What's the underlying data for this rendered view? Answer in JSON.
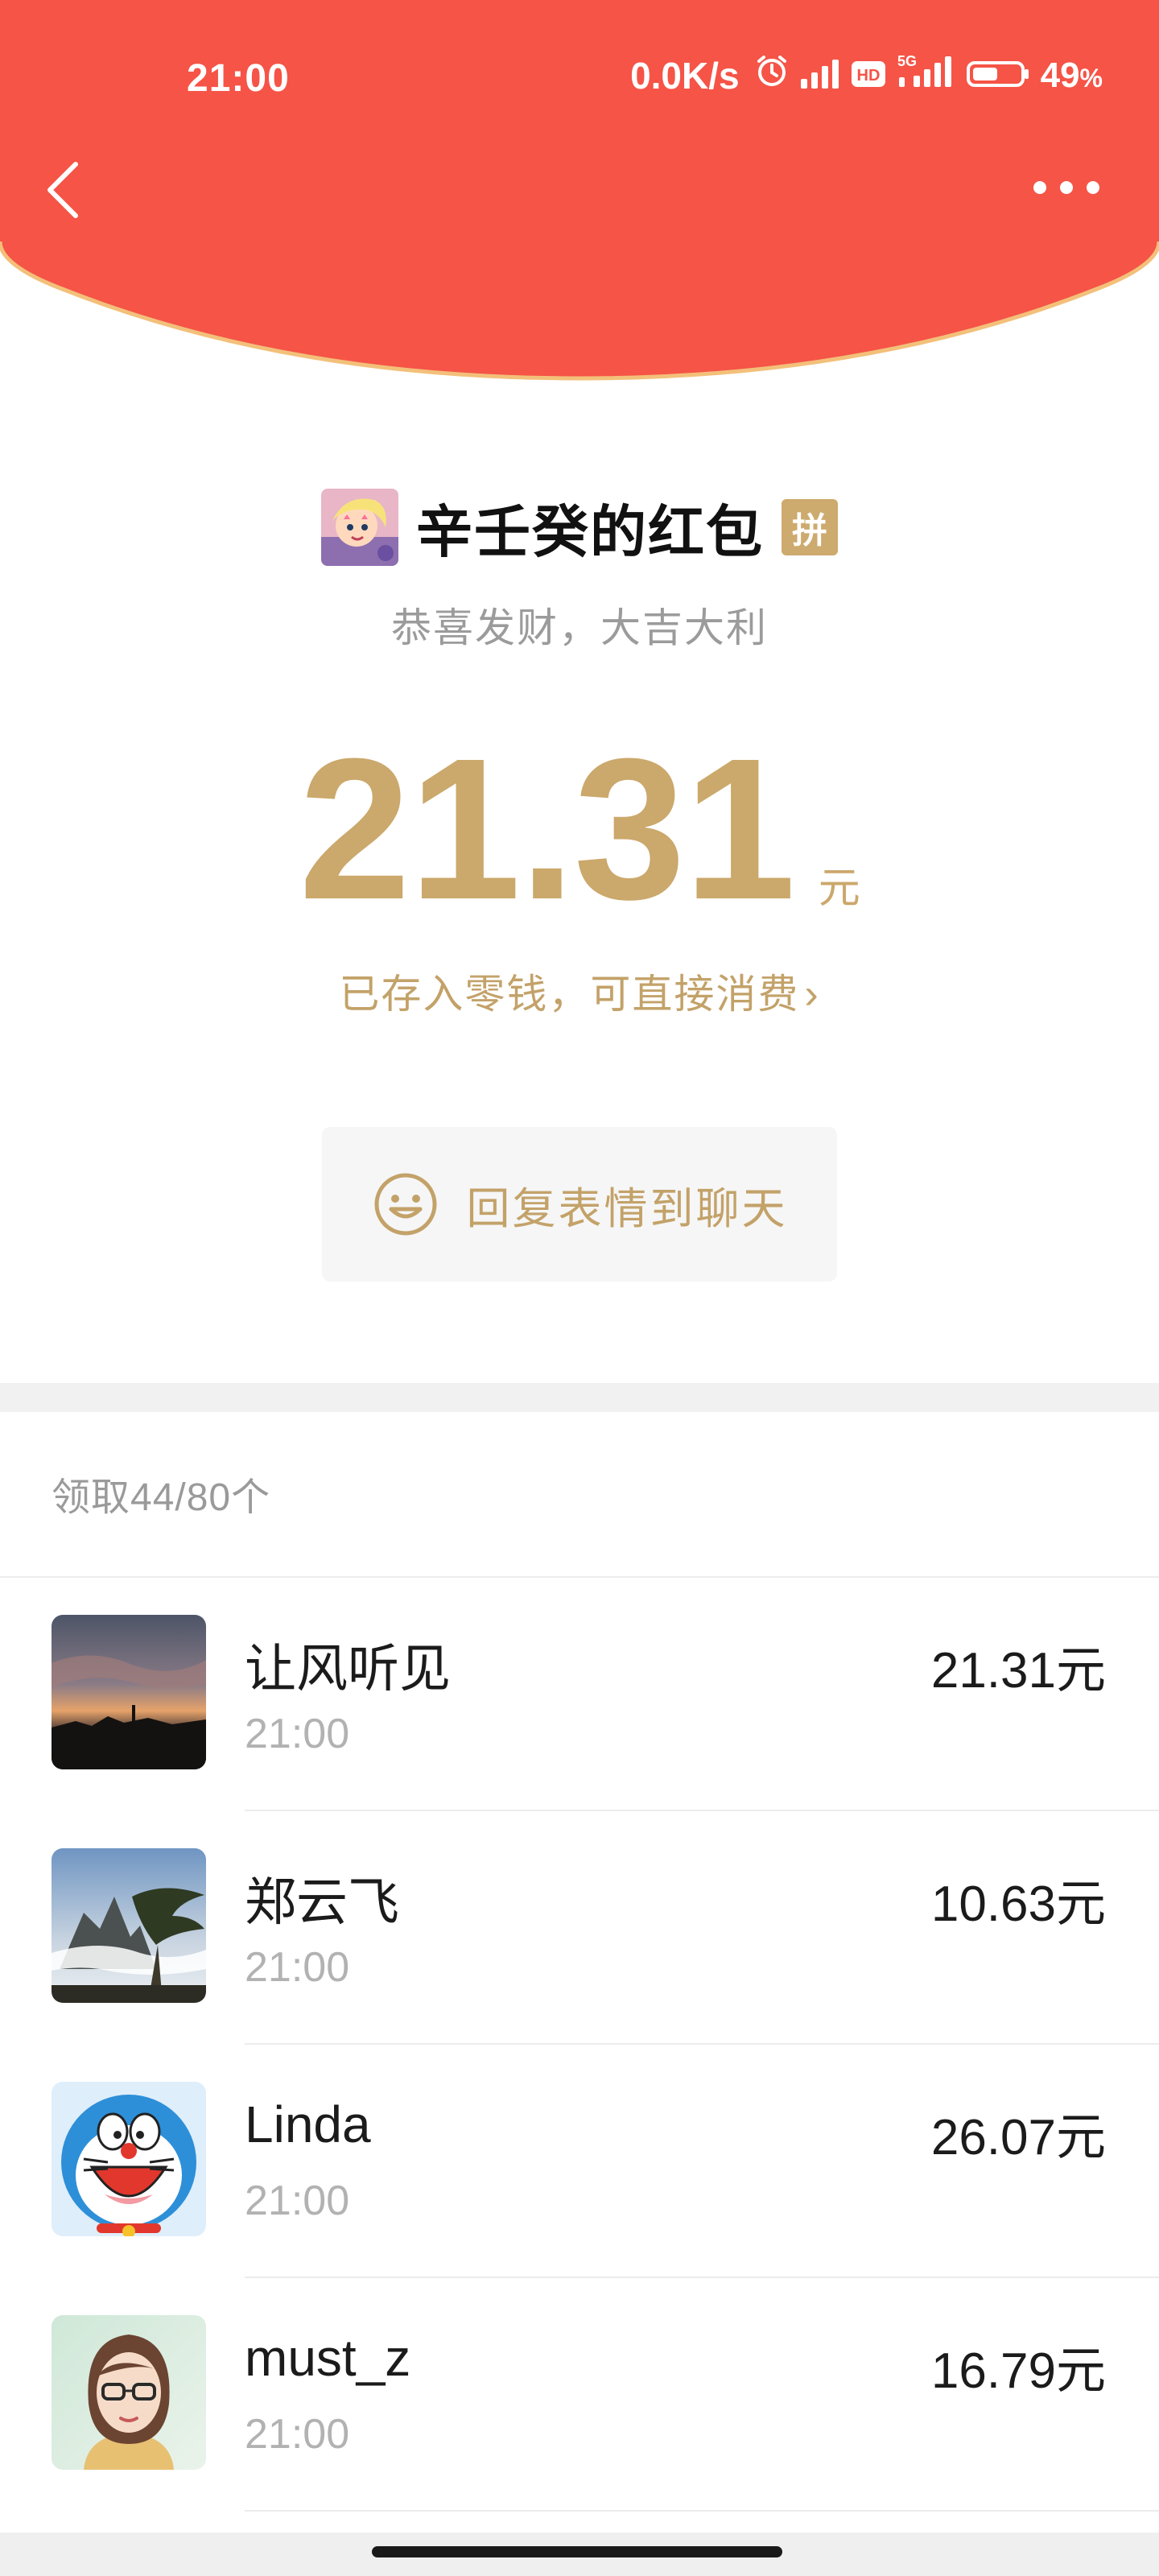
{
  "status_bar": {
    "time": "21:00",
    "net_speed": "0.0K/s",
    "battery_percent": "49",
    "battery_symbol": "%",
    "hd_label": "HD",
    "network_label": "5G"
  },
  "colors": {
    "header_red": "#f55447",
    "gold": "#cba86b",
    "gold_text": "#c3a269"
  },
  "packet": {
    "sender_title": "辛壬癸的红包",
    "badge": "拼",
    "blessing": "恭喜发财，大吉大利",
    "amount": "21.31",
    "amount_unit": "元",
    "saved_link": "已存入零钱，可直接消费",
    "saved_link_chevron": "›"
  },
  "reply": {
    "label": "回复表情到聊天",
    "icon": "smiley-icon"
  },
  "claims": {
    "summary": "领取44/80个",
    "items": [
      {
        "name": "让风听见",
        "time": "21:00",
        "amount": "21.31元",
        "avatar": "sunset-avatar"
      },
      {
        "name": "郑云飞",
        "time": "21:00",
        "amount": "10.63元",
        "avatar": "mountain-avatar"
      },
      {
        "name": "Linda",
        "time": "21:00",
        "amount": "26.07元",
        "avatar": "doraemon-avatar"
      },
      {
        "name": "must_z",
        "time": "21:00",
        "amount": "16.79元",
        "avatar": "woman-glasses-avatar"
      }
    ]
  }
}
